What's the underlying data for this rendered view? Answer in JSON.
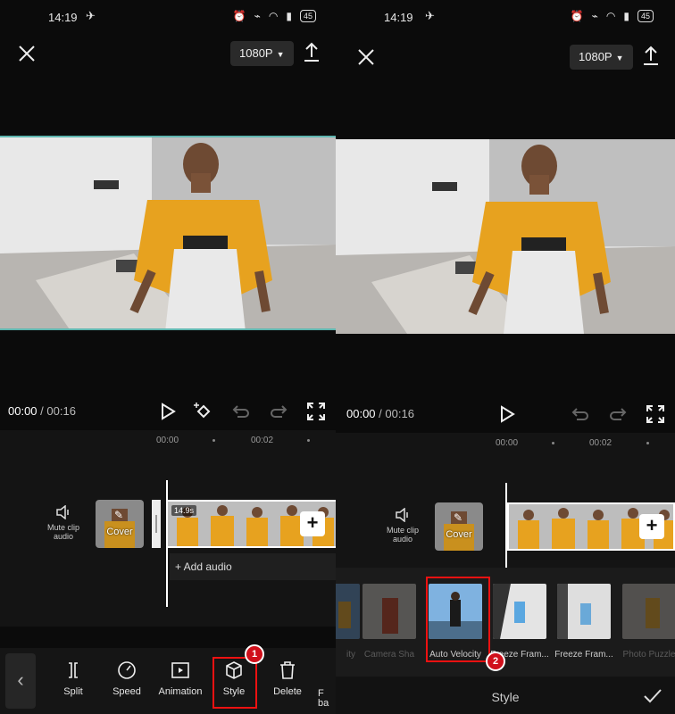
{
  "status": {
    "time": "14:19",
    "battery": "45"
  },
  "left": {
    "resolution": "1080P",
    "time_current": "00:00",
    "time_total": "/ 00:16",
    "ruler": [
      "00:00",
      "00:02"
    ],
    "mute_label": "Mute clip audio",
    "cover_label": "Cover",
    "clip_duration": "14.9s",
    "add_audio": "+  Add audio",
    "tools": [
      {
        "label": "Split",
        "icon": "split-icon"
      },
      {
        "label": "Speed",
        "icon": "speed-icon"
      },
      {
        "label": "Animation",
        "icon": "animation-icon"
      },
      {
        "label": "Style",
        "icon": "cube-icon"
      },
      {
        "label": "Delete",
        "icon": "trash-icon"
      },
      {
        "label": "F ba",
        "icon": ""
      }
    ],
    "badge": "1"
  },
  "right": {
    "resolution": "1080P",
    "time_current": "00:00",
    "time_total": "/ 00:16",
    "ruler": [
      "00:00",
      "00:02"
    ],
    "mute_label": "Mute clip audio",
    "cover_label": "Cover",
    "styles": [
      {
        "label": "ity"
      },
      {
        "label": "Camera Sha"
      },
      {
        "label": "Auto Velocity"
      },
      {
        "label": "Freeze Fram..."
      },
      {
        "label": "Freeze Fram..."
      },
      {
        "label": "Photo Puzzle"
      }
    ],
    "badge": "2",
    "panel_title": "Style"
  },
  "colors": {
    "accent_red": "#d0101b",
    "clip_bg": "#ffffff",
    "shirt": "#e7a21f"
  }
}
